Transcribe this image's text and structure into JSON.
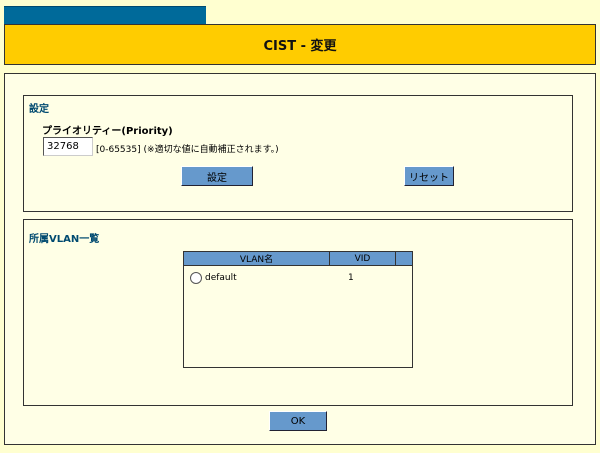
{
  "header": {
    "title": "CIST - 変更"
  },
  "settings": {
    "heading": "設定",
    "priority_label": "プライオリティー(Priority)",
    "priority_value": "32768",
    "priority_range": "[0-65535]",
    "priority_note": "(※適切な値に自動補正されます。)",
    "apply_label": "設定",
    "reset_label": "リセット"
  },
  "vlan_list": {
    "heading": "所属VLAN一覧",
    "columns": [
      "VLAN名",
      "VID"
    ],
    "rows": [
      {
        "name": "default",
        "vid": "1",
        "selected": false
      }
    ]
  },
  "footer": {
    "ok_label": "OK"
  }
}
